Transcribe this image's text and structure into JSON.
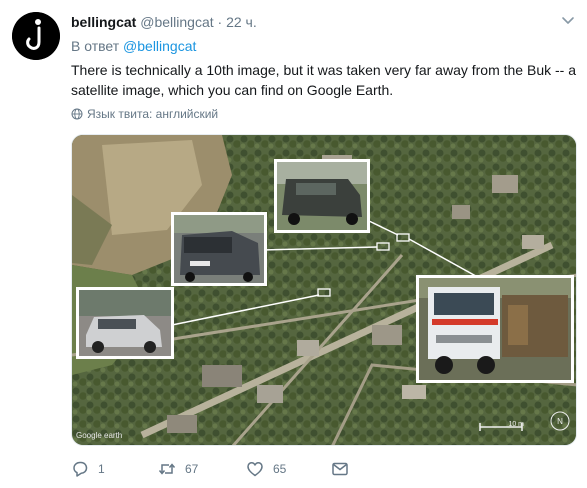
{
  "tweet": {
    "author_name": "bellingcat",
    "author_handle": "@bellingcat",
    "separator": "·",
    "time": "22 ч.",
    "reply_prefix": "В ответ",
    "reply_handle": "@bellingcat",
    "text": "There is technically a 10th image, but it was taken very far away from the Buk -- a satellite image, which you can find on Google Earth.",
    "language_label": "Язык твита: английский"
  },
  "media": {
    "watermark": "Google earth",
    "scale": "10 m"
  },
  "actions": {
    "replies": "1",
    "retweets": "67",
    "likes": "65"
  },
  "colors": {
    "link": "#1b95e0",
    "muted": "#657786"
  },
  "icons": [
    "avatar-hook-icon",
    "chevron-down-icon",
    "globe-icon",
    "reply-icon",
    "retweet-icon",
    "like-icon",
    "dm-icon"
  ]
}
